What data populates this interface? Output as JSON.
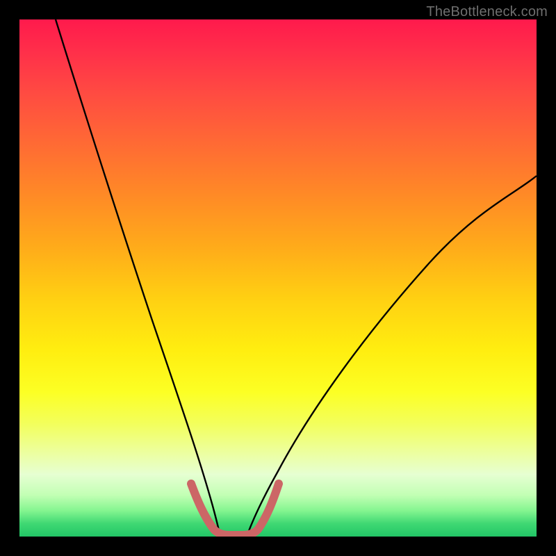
{
  "watermark": "TheBottleneck.com",
  "chart_data": {
    "type": "line",
    "title": "",
    "xlabel": "",
    "ylabel": "",
    "xlim": [
      0,
      100
    ],
    "ylim": [
      0,
      100
    ],
    "background_gradient_stops": [
      {
        "pos": 0,
        "color": "#ff1a4c"
      },
      {
        "pos": 50,
        "color": "#ffd012"
      },
      {
        "pos": 75,
        "color": "#fcff24"
      },
      {
        "pos": 95,
        "color": "#84f590"
      },
      {
        "pos": 100,
        "color": "#22c566"
      }
    ],
    "series": [
      {
        "name": "bottleneck-curve-left",
        "color": "#000000",
        "x": [
          7,
          10,
          14,
          18,
          22,
          26,
          29,
          32,
          34.5,
          36.5,
          38
        ],
        "y": [
          100,
          90,
          77,
          64,
          50,
          36,
          25,
          14,
          6,
          2,
          0
        ]
      },
      {
        "name": "bottleneck-curve-right",
        "color": "#000000",
        "x": [
          44,
          46,
          49,
          53,
          58,
          64,
          71,
          79,
          88,
          96,
          100
        ],
        "y": [
          0,
          2,
          6,
          12,
          20,
          29,
          38,
          48,
          58,
          66,
          70
        ]
      },
      {
        "name": "optimal-band-marker",
        "color": "#cc6666",
        "x": [
          33,
          34.5,
          36,
          37.5,
          39,
          41,
          43,
          44.5,
          46,
          47.5,
          49
        ],
        "y": [
          10,
          6,
          3,
          1,
          0,
          0,
          0,
          1,
          3,
          6,
          10
        ]
      }
    ]
  }
}
